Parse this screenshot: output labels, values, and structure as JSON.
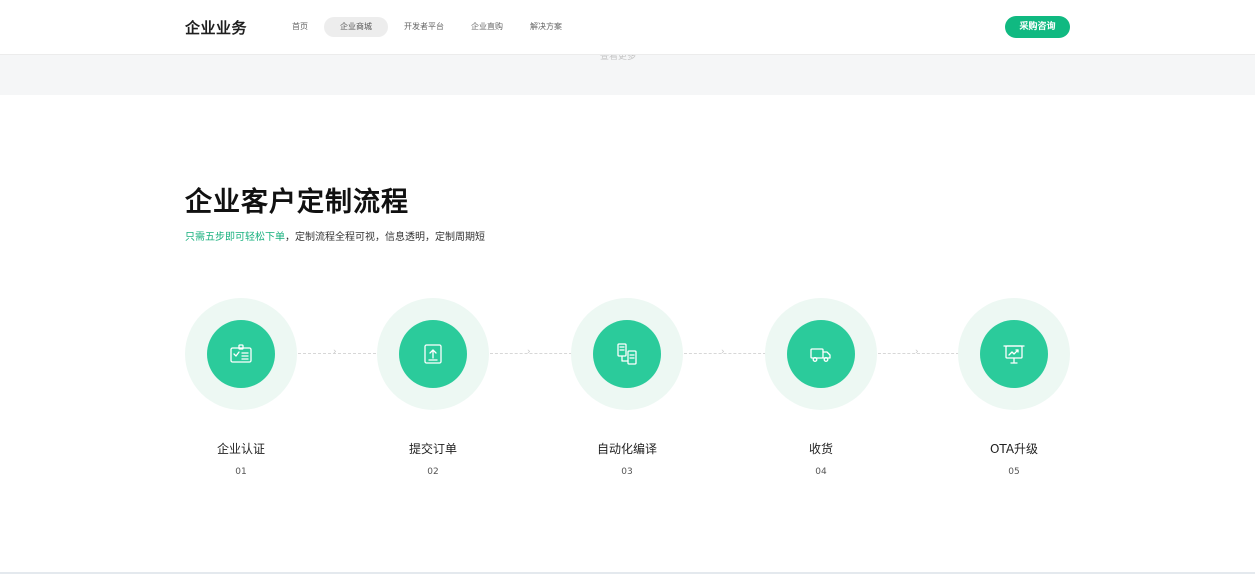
{
  "header": {
    "brand": "企业业务",
    "nav": [
      "首页",
      "企业商城",
      "开发者平台",
      "企业直购",
      "解决方案"
    ],
    "cta": "采购咨询"
  },
  "band": {
    "text": "查看更多"
  },
  "section": {
    "title": "企业客户定制流程",
    "subtitle_highlight": "只需五步即可轻松下单",
    "subtitle_rest": "，定制流程全程可视，信息透明，定制周期短"
  },
  "steps": [
    {
      "name": "企业认证",
      "num": "01",
      "icon": "id-card-icon"
    },
    {
      "name": "提交订单",
      "num": "02",
      "icon": "order-icon"
    },
    {
      "name": "自动化编译",
      "num": "03",
      "icon": "compile-icon"
    },
    {
      "name": "收货",
      "num": "04",
      "icon": "truck-icon"
    },
    {
      "name": "OTA升级",
      "num": "05",
      "icon": "upgrade-icon"
    }
  ],
  "colors": {
    "accent": "#10b981",
    "disc": "#2bcb9b",
    "ring": "#edf8f3",
    "highlight_text": "#16b07d"
  }
}
